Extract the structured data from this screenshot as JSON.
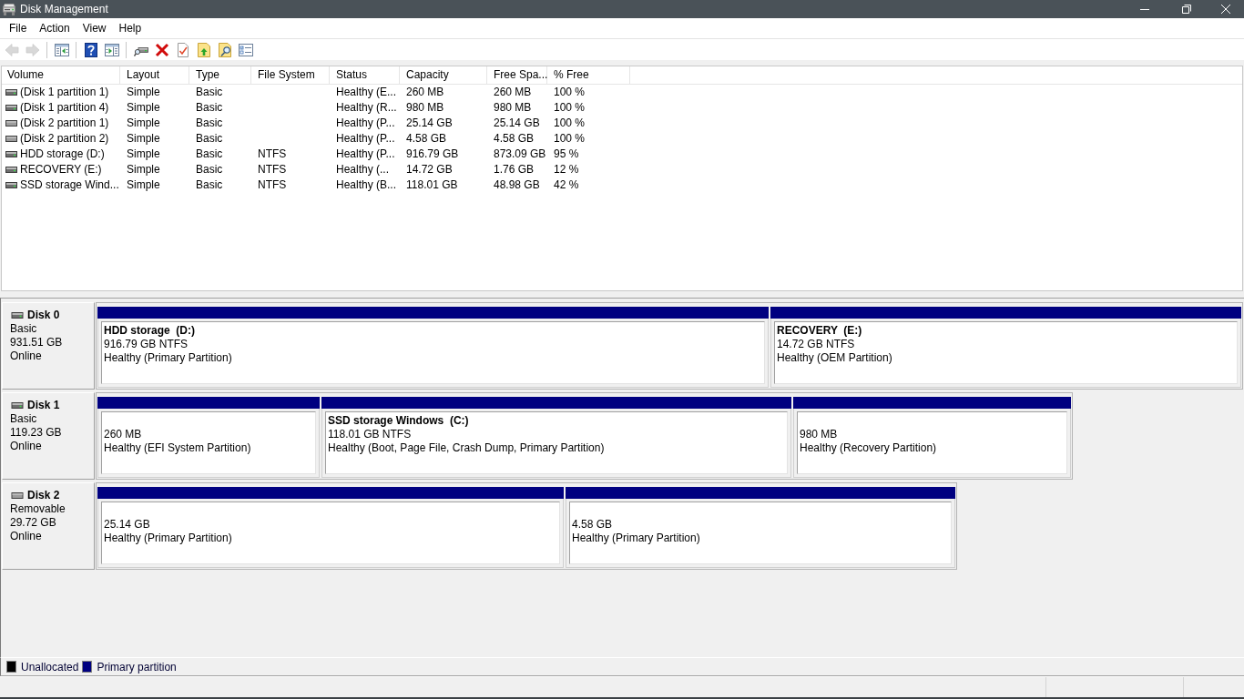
{
  "window": {
    "title": "Disk Management"
  },
  "menu": [
    "File",
    "Action",
    "View",
    "Help"
  ],
  "toolbar": [
    [
      {
        "kind": "back",
        "disabled": true
      },
      {
        "kind": "forward",
        "disabled": true
      }
    ],
    [
      {
        "kind": "tree",
        "disabled": false
      }
    ],
    [
      {
        "kind": "help",
        "disabled": false
      },
      {
        "kind": "pane",
        "disabled": false
      }
    ],
    [
      {
        "kind": "drive",
        "disabled": false
      },
      {
        "kind": "delete",
        "disabled": false
      },
      {
        "kind": "properties",
        "disabled": false
      },
      {
        "kind": "folder-up",
        "disabled": false
      },
      {
        "kind": "folder-search",
        "disabled": false
      },
      {
        "kind": "checklist",
        "disabled": false
      }
    ]
  ],
  "volumes": {
    "columns": [
      "Volume",
      "Layout",
      "Type",
      "File System",
      "Status",
      "Capacity",
      "Free Spa...",
      "% Free"
    ],
    "rows": [
      {
        "kind": "fixed",
        "volume": "(Disk 1 partition 1)",
        "layout": "Simple",
        "type": "Basic",
        "status": "Healthy (E...",
        "capacity": "260 MB",
        "free_space": "260 MB",
        "percent_free": "100 %"
      },
      {
        "kind": "fixed",
        "volume": "(Disk 1 partition 4)",
        "layout": "Simple",
        "type": "Basic",
        "status": "Healthy (R...",
        "capacity": "980 MB",
        "free_space": "980 MB",
        "percent_free": "100 %"
      },
      {
        "kind": "removable",
        "volume": "(Disk 2 partition 1)",
        "layout": "Simple",
        "type": "Basic",
        "status": "Healthy (P...",
        "capacity": "25.14 GB",
        "free_space": "25.14 GB",
        "percent_free": "100 %"
      },
      {
        "kind": "removable",
        "volume": "(Disk 2 partition 2)",
        "layout": "Simple",
        "type": "Basic",
        "status": "Healthy (P...",
        "capacity": "4.58 GB",
        "free_space": "4.58 GB",
        "percent_free": "100 %"
      },
      {
        "kind": "fixed",
        "volume": "HDD storage (D:)",
        "layout": "Simple",
        "type": "Basic",
        "file_system": "NTFS",
        "status": "Healthy (P...",
        "capacity": "916.79 GB",
        "free_space": "873.09 GB",
        "percent_free": "95 %"
      },
      {
        "kind": "fixed",
        "volume": "RECOVERY (E:)",
        "layout": "Simple",
        "type": "Basic",
        "file_system": "NTFS",
        "status": "Healthy (...",
        "capacity": "14.72 GB",
        "free_space": "1.76 GB",
        "percent_free": "12 %"
      },
      {
        "kind": "fixed",
        "volume": "SSD storage Wind...",
        "layout": "Simple",
        "type": "Basic",
        "file_system": "NTFS",
        "status": "Healthy (B...",
        "capacity": "118.01 GB",
        "free_space": "48.98 GB",
        "percent_free": "42 %"
      }
    ]
  },
  "disks": [
    {
      "name": "Disk 0",
      "kind": "fixed",
      "type": "Basic",
      "size": "931.51 GB",
      "status": "Online",
      "partitions": [
        {
          "name": "HDD storage  (D:)",
          "size": "916.79 GB NTFS",
          "status": "Healthy (Primary Partition)",
          "color": "#000080"
        },
        {
          "name": "RECOVERY  (E:)",
          "size": "14.72 GB NTFS",
          "status": "Healthy (OEM Partition)",
          "color": "#000080"
        }
      ]
    },
    {
      "name": "Disk 1",
      "kind": "fixed",
      "type": "Basic",
      "size": "119.23 GB",
      "status": "Online",
      "partitions": [
        {
          "size": "260 MB",
          "status": "Healthy (EFI System Partition)",
          "color": "#000080"
        },
        {
          "name": "SSD storage Windows  (C:)",
          "size": "118.01 GB NTFS",
          "status": "Healthy (Boot, Page File, Crash Dump, Primary Partition)",
          "color": "#000080"
        },
        {
          "size": "980 MB",
          "status": "Healthy (Recovery Partition)",
          "color": "#000080"
        }
      ]
    },
    {
      "name": "Disk 2",
      "kind": "removable",
      "type": "Removable",
      "size": "29.72 GB",
      "status": "Online",
      "partitions": [
        {
          "size": "25.14 GB",
          "status": "Healthy (Primary Partition)",
          "color": "#000080"
        },
        {
          "size": "4.58 GB",
          "status": "Healthy (Primary Partition)",
          "color": "#000080"
        }
      ]
    }
  ],
  "legend": [
    {
      "label": "Unallocated",
      "color": "#000000"
    },
    {
      "label": "Primary partition",
      "color": "#000080"
    }
  ]
}
